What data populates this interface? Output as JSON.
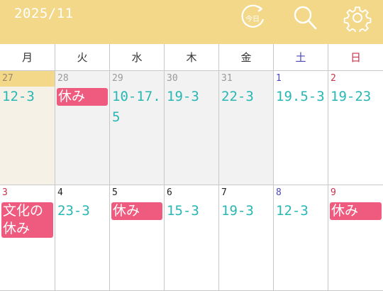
{
  "header": {
    "month": "2025/11",
    "today_icon": "today-calendar-icon",
    "today_icon_label": "今日",
    "search_icon": "search-icon",
    "settings_icon": "gear-icon"
  },
  "colors": {
    "header_bg": "#f3d889",
    "shift_text": "#27b7b4",
    "off_bg": "#ef5b7f",
    "saturday": "#4a46b8",
    "sunday": "#c8324a",
    "holiday": "#c8324a"
  },
  "weekdays": [
    {
      "label": "月",
      "color": "#333333"
    },
    {
      "label": "火",
      "color": "#333333"
    },
    {
      "label": "水",
      "color": "#333333"
    },
    {
      "label": "木",
      "color": "#333333"
    },
    {
      "label": "金",
      "color": "#333333"
    },
    {
      "label": "土",
      "color": "#4a46b8"
    },
    {
      "label": "日",
      "color": "#c8324a"
    }
  ],
  "weeks": [
    [
      {
        "day": "27",
        "state": "today",
        "events": [
          {
            "text": "12-3",
            "kind": "shift"
          }
        ]
      },
      {
        "day": "28",
        "state": "other",
        "events": [
          {
            "text": "休み",
            "kind": "off"
          }
        ]
      },
      {
        "day": "29",
        "state": "other",
        "events": [
          {
            "text": "10-17.5",
            "kind": "shift"
          }
        ]
      },
      {
        "day": "30",
        "state": "other",
        "events": [
          {
            "text": "19-3",
            "kind": "shift"
          }
        ]
      },
      {
        "day": "31",
        "state": "other",
        "events": [
          {
            "text": "22-3",
            "kind": "shift"
          }
        ]
      },
      {
        "day": "1",
        "state": "current",
        "day_color": "#4a46b8",
        "events": [
          {
            "text": "19.5-3",
            "kind": "shift"
          }
        ]
      },
      {
        "day": "2",
        "state": "current",
        "day_color": "#c8324a",
        "events": [
          {
            "text": "19-23",
            "kind": "shift"
          }
        ]
      }
    ],
    [
      {
        "day": "3",
        "state": "current",
        "day_color": "#c8324a",
        "events": [
          {
            "text": "文化の休み",
            "kind": "off"
          }
        ]
      },
      {
        "day": "4",
        "state": "current",
        "events": [
          {
            "text": "23-3",
            "kind": "shift"
          }
        ]
      },
      {
        "day": "5",
        "state": "current",
        "events": [
          {
            "text": "休み",
            "kind": "off"
          }
        ]
      },
      {
        "day": "6",
        "state": "current",
        "events": [
          {
            "text": "15-3",
            "kind": "shift"
          }
        ]
      },
      {
        "day": "7",
        "state": "current",
        "events": [
          {
            "text": "19-3",
            "kind": "shift"
          }
        ]
      },
      {
        "day": "8",
        "state": "current",
        "day_color": "#4a46b8",
        "events": [
          {
            "text": "12-3",
            "kind": "shift"
          }
        ]
      },
      {
        "day": "9",
        "state": "current",
        "day_color": "#c8324a",
        "events": [
          {
            "text": "休み",
            "kind": "off"
          }
        ]
      }
    ]
  ]
}
